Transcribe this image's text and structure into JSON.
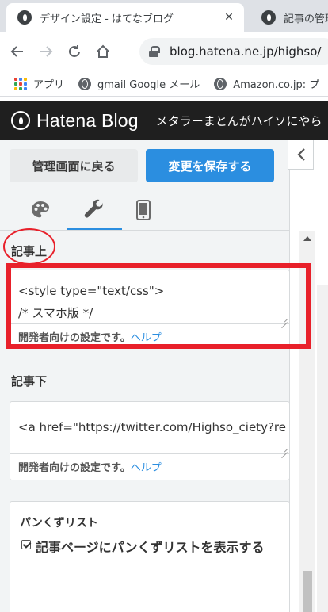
{
  "browser": {
    "tabs": [
      {
        "title": "デザイン設定 - はてなブログ",
        "active": true
      },
      {
        "title": "記事の管理",
        "active": false
      }
    ],
    "address": "blog.hatena.ne.jp/highso/",
    "bookmarks": [
      {
        "label": "アプリ",
        "icon": "apps-grid-icon"
      },
      {
        "label": "gmail Google メール",
        "icon": "globe-icon"
      },
      {
        "label": "Amazon.co.jp: プ",
        "icon": "globe-icon"
      }
    ]
  },
  "header": {
    "logo_text": "Hatena Blog",
    "blog_title": "メタラーまとんがハイソにやら"
  },
  "panel": {
    "back_label": "管理画面に戻る",
    "save_label": "変更を保存する",
    "icon_tabs": [
      "palette-icon",
      "wrench-icon",
      "smartphone-icon"
    ],
    "sections": [
      {
        "title": "記事上",
        "code_line1": "<style type=\"text/css\">",
        "code_line2": "/* スマホ版 */",
        "note": "開発者向けの設定です。",
        "help": "ヘルプ"
      },
      {
        "title": "記事下",
        "code_line1": "<a href=\"https://twitter.com/Highso_ciety?re",
        "note": "開発者向けの設定です。",
        "help": "ヘルプ"
      }
    ],
    "breadcrumb": {
      "title": "パンくずリスト",
      "checkbox_label": "記事ページにパンくずリストを表示する",
      "checked": true
    }
  },
  "colors": {
    "accent": "#2b8ee0",
    "header_bg": "#1f1f1f",
    "annotation_red": "#e8202a"
  }
}
